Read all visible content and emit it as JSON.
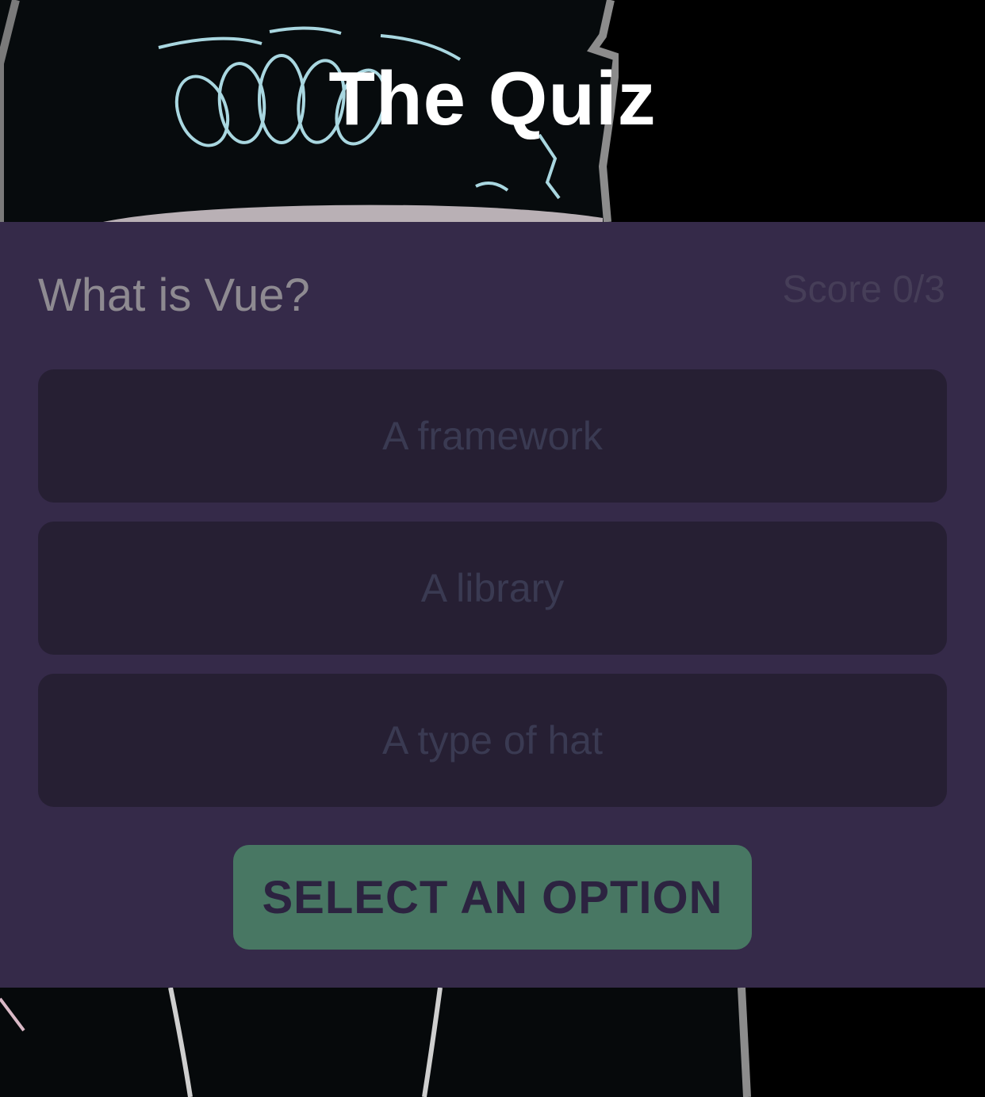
{
  "header": {
    "title": "The Quiz"
  },
  "quiz": {
    "question": "What is Vue?",
    "score_label": "Score 0/3",
    "options": [
      {
        "label": "A framework"
      },
      {
        "label": "A library"
      },
      {
        "label": "A type of hat"
      }
    ],
    "submit_label": "SELECT AN OPTION"
  },
  "colors": {
    "panel": "#352a49",
    "option_bg": "#261f33",
    "submit_bg": "#487763",
    "submit_text": "#2c2340",
    "title_text": "#ffffff"
  },
  "background": {
    "icon": "hat-photo-background"
  }
}
